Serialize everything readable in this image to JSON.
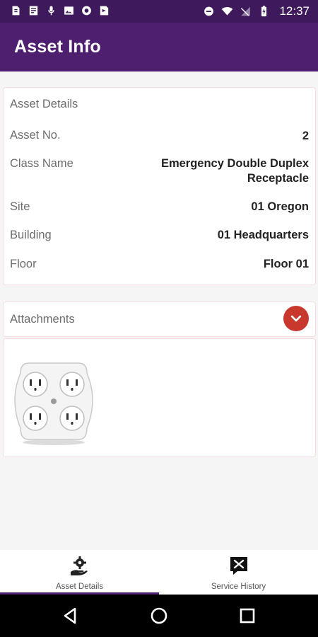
{
  "status_bar": {
    "time": "12:37",
    "left_icons": [
      "data-saver-icon",
      "tasks-icon",
      "microphone-icon",
      "image-icon",
      "circle-app-icon",
      "play-store-icon"
    ],
    "right_icons": [
      "do-not-disturb-icon",
      "wifi-icon",
      "no-signal-icon",
      "battery-charging-icon"
    ]
  },
  "app_bar": {
    "title": "Asset Info"
  },
  "asset_details": {
    "heading": "Asset Details",
    "rows": [
      {
        "label": "Asset No.",
        "value": "2"
      },
      {
        "label": "Class Name",
        "value_line1": "Emergency Double Duplex",
        "value_line2": "Receptacle"
      },
      {
        "label": "Site",
        "value": "01 Oregon"
      },
      {
        "label": "Building",
        "value": "01 Headquarters"
      },
      {
        "label": "Floor",
        "value": "Floor 01"
      }
    ]
  },
  "attachments": {
    "label": "Attachments",
    "toggle_icon": "chevron-down-icon",
    "items": [
      {
        "type": "image",
        "subject": "quad-outlet-receptacle"
      }
    ]
  },
  "bottom_nav": {
    "tabs": [
      {
        "label": "Asset Details",
        "icon": "asset-gear-hand-icon",
        "active": true
      },
      {
        "label": "Service History",
        "icon": "tools-icon",
        "active": false
      }
    ]
  },
  "system_nav": [
    "back-icon",
    "home-icon",
    "recents-icon"
  ],
  "colors": {
    "status_bar": "#3e1a5c",
    "app_bar": "#4d1f6e",
    "accent_red": "#c8382d"
  }
}
